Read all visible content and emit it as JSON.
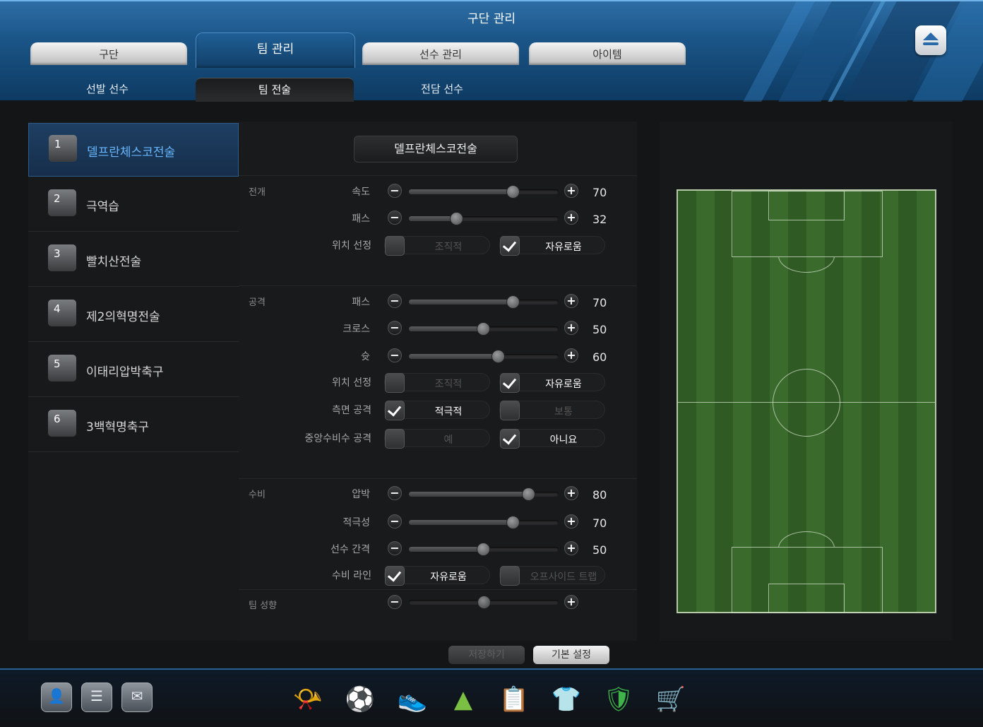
{
  "window": {
    "title": "구단 관리"
  },
  "tabs": [
    {
      "label": "구단"
    },
    {
      "label": "팀 관리",
      "active": true
    },
    {
      "label": "선수 관리"
    },
    {
      "label": "아이템"
    }
  ],
  "subtabs": [
    {
      "label": "선발 선수"
    },
    {
      "label": "팀 전술",
      "active": true
    },
    {
      "label": "전담 선수"
    }
  ],
  "tactics": [
    {
      "num": "1",
      "name": "델프란체스코전술"
    },
    {
      "num": "2",
      "name": "극역습"
    },
    {
      "num": "3",
      "name": "빨치산전술"
    },
    {
      "num": "4",
      "name": "제2의혁명전술"
    },
    {
      "num": "5",
      "name": "이태리압박축구"
    },
    {
      "num": "6",
      "name": "3백혁명축구"
    }
  ],
  "selected_tactic": "델프란체스코전술",
  "sections": {
    "buildup": "전개",
    "attack": "공격",
    "defense": "수비",
    "tendency": "팀 성향"
  },
  "sliders": [
    {
      "label": "속도",
      "value": 70
    },
    {
      "label": "패스",
      "value": 32
    },
    {
      "label": "패스",
      "value": 70
    },
    {
      "label": "크로스",
      "value": 50
    },
    {
      "label": "슛",
      "value": 60
    },
    {
      "label": "압박",
      "value": 80
    },
    {
      "label": "적극성",
      "value": 70
    },
    {
      "label": "선수 간격",
      "value": 50
    }
  ],
  "options": [
    {
      "label": "위치 선정",
      "a": "조직적",
      "a_on": false,
      "b": "자유로움",
      "b_on": true
    },
    {
      "label": "위치 선정",
      "a": "조직적",
      "a_on": false,
      "b": "자유로움",
      "b_on": true
    },
    {
      "label": "측면 공격",
      "a": "적극적",
      "a_on": true,
      "b": "보통",
      "b_on": false
    },
    {
      "label": "중앙수비수 공격",
      "a": "예",
      "a_on": false,
      "b": "아니요",
      "b_on": true
    },
    {
      "label": "수비 라인",
      "a": "자유로움",
      "a_on": true,
      "b": "오프사이드 트랩",
      "b_on": false
    }
  ],
  "team_tendency_step": 3,
  "controls": {
    "minus": "−",
    "plus": "+"
  },
  "buttons": {
    "save": "저장하기",
    "reset": "기본 설정"
  },
  "footer": {
    "left": [
      {
        "icon": "profile-icon",
        "glyph": "👤"
      },
      {
        "icon": "chat-icon",
        "glyph": "☰"
      },
      {
        "icon": "mail-icon",
        "glyph": "✉"
      }
    ],
    "dock": [
      {
        "icon": "whistle-icon",
        "glyph": "📯"
      },
      {
        "icon": "ball-icon",
        "glyph": "⚽"
      },
      {
        "icon": "boots-icon",
        "glyph": "👟"
      },
      {
        "icon": "ranking-icon",
        "glyph": "▲"
      },
      {
        "icon": "clipboard-icon",
        "glyph": "📋"
      },
      {
        "icon": "jersey-icon",
        "glyph": "👕"
      },
      {
        "icon": "club-icon",
        "glyph": "🛡"
      },
      {
        "icon": "cart-icon",
        "glyph": "🛒"
      }
    ]
  },
  "colors": {
    "accent": "#1a5486",
    "selected_text": "#67b6ff",
    "pitch": "#3a6a2c"
  }
}
